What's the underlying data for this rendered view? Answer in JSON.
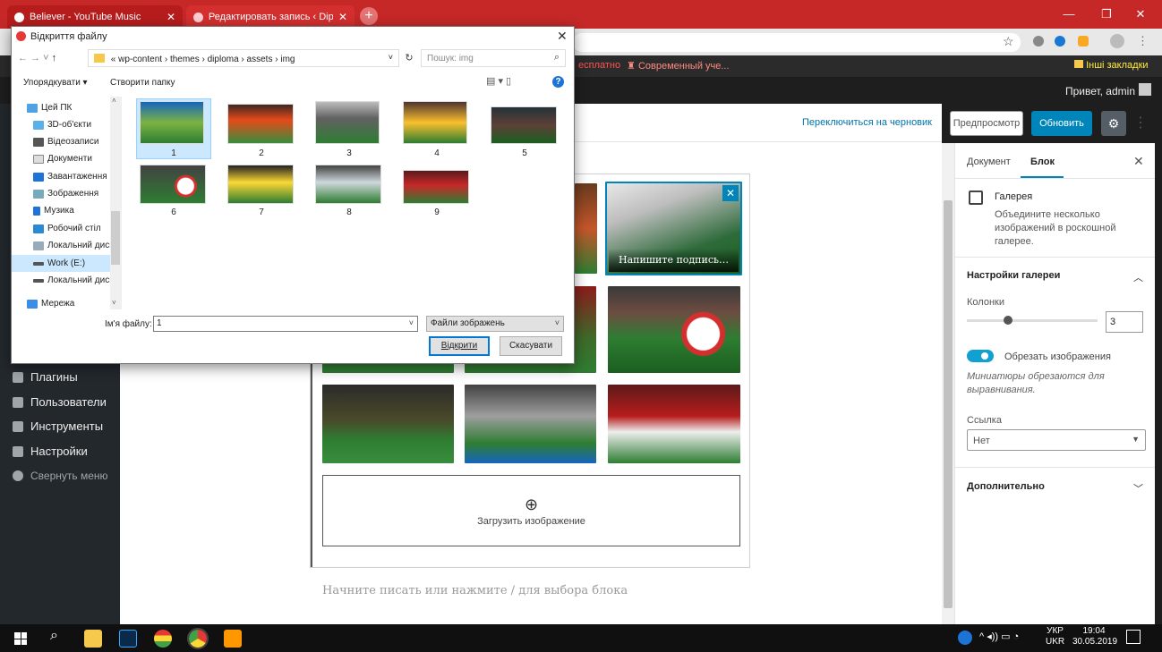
{
  "browser": {
    "tabs": [
      {
        "title": "Believer - YouTube Music"
      },
      {
        "title": "Редактировать запись ‹ Diplom"
      }
    ],
    "bookmarks": [
      "есплатно",
      "Современный уче...",
      "Інші закладки"
    ]
  },
  "admin_bar": {
    "greeting": "Привет, admin"
  },
  "left_menu": {
    "items": [
      "Плагины",
      "Пользователи",
      "Инструменты",
      "Настройки",
      "Свернуть меню"
    ]
  },
  "editor_toolbar": {
    "switch_draft": "Переключиться на черновик",
    "preview": "Предпросмотр",
    "update": "Обновить"
  },
  "gallery": {
    "caption_placeholder": "Напишите подпись…",
    "upload_label": "Загрузить изображение"
  },
  "editor": {
    "placeholder": "Начните писать или нажмите / для выбора блока"
  },
  "sidebar": {
    "tabs": [
      "Документ",
      "Блок"
    ],
    "block_title": "Галерея",
    "block_desc": "Объедините несколько изображений в роскошной галерее.",
    "settings_title": "Настройки галереи",
    "columns_label": "Колонки",
    "columns_value": "3",
    "columns_level": 0.33,
    "crop_label": "Обрезать изображения",
    "crop_on": true,
    "crop_help": "Миниатюры обрезаются для выравнивания.",
    "link_label": "Ссылка",
    "link_value": "Нет",
    "advanced": "Дополнительно"
  },
  "dialog": {
    "title": "Відкриття файлу",
    "path": [
      "«",
      "wp-content",
      "themes",
      "diploma",
      "assets",
      "img"
    ],
    "search_placeholder": "Пошук: img",
    "organize": "Упорядкувати ▾",
    "new_folder": "Створити папку",
    "nav": [
      "Цей ПК",
      "3D-об'єкти",
      "Відеозаписи",
      "Документи",
      "Завантаження",
      "Зображення",
      "Музика",
      "Робочий стіл",
      "Локальний диск",
      "Work (E:)",
      "Локальний диск",
      "Мережа"
    ],
    "files": [
      "1",
      "2",
      "3",
      "4",
      "5",
      "6",
      "7",
      "8",
      "9"
    ],
    "filename_label": "Ім'я файлу:",
    "filename_value": "1",
    "filetype": "Файли зображень",
    "open": "Відкрити",
    "cancel": "Скасувати"
  },
  "taskbar": {
    "lang": "УКР",
    "lang2": "UKR",
    "time": "19:04",
    "date": "30.05.2019"
  },
  "colors": {
    "wp_blue": "#0085ba",
    "browser_red": "#c62828",
    "admin_dark": "#23282d"
  }
}
